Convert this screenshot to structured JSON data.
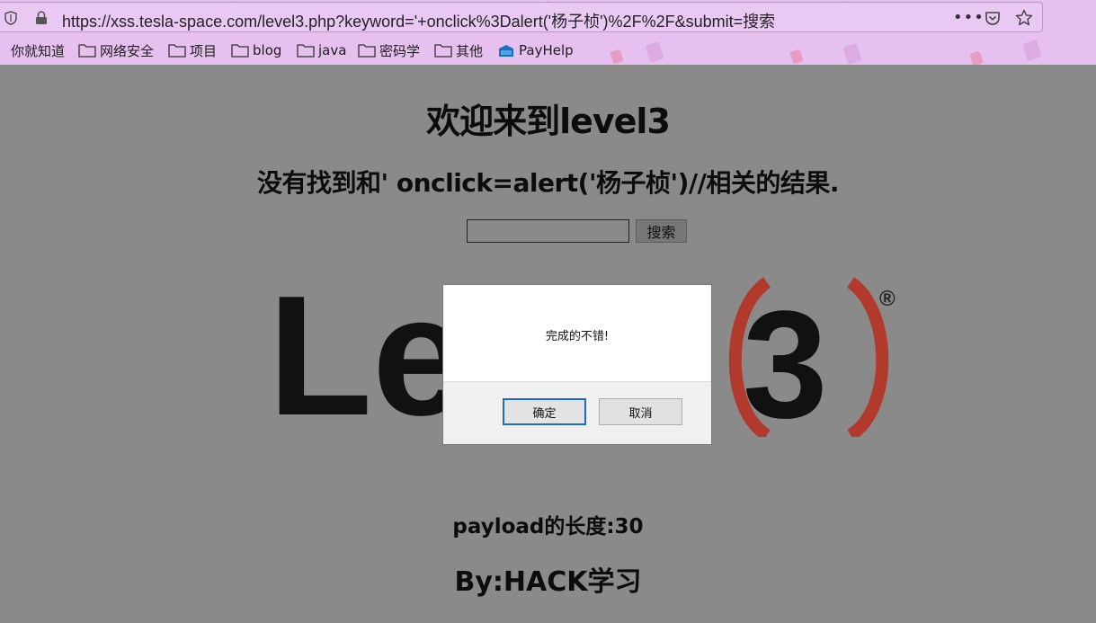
{
  "browser": {
    "url": "https://xss.tesla-space.com/level3.php?keyword='+onclick%3Dalert('杨子桢')%2F%2F&submit=搜索",
    "more_label": "•••",
    "bookmarks": [
      {
        "label": "你就知道",
        "icon": "none"
      },
      {
        "label": "网络安全",
        "icon": "folder-icon"
      },
      {
        "label": "项目",
        "icon": "folder-icon"
      },
      {
        "label": "blog",
        "icon": "folder-icon"
      },
      {
        "label": "java",
        "icon": "folder-icon"
      },
      {
        "label": "密码学",
        "icon": "folder-icon"
      },
      {
        "label": "其他",
        "icon": "folder-icon"
      },
      {
        "label": "PayHelp",
        "icon": "payhelp-icon"
      }
    ],
    "theme_color": "#e6c0ef"
  },
  "page": {
    "title": "欢迎来到level3",
    "result_text": "没有找到和' onclick=alert('杨子桢')//相关的结果.",
    "search_value": "",
    "search_button": "搜索",
    "logo": {
      "text": "Lev",
      "number": "3",
      "registered": "®"
    },
    "payload_length": "payload的长度:30",
    "author": "By:HACK学习",
    "background": "#8a8a8a"
  },
  "dialog": {
    "message": "完成的不错!",
    "ok_label": "确定",
    "cancel_label": "取消",
    "accent": "#1c6cc9"
  }
}
